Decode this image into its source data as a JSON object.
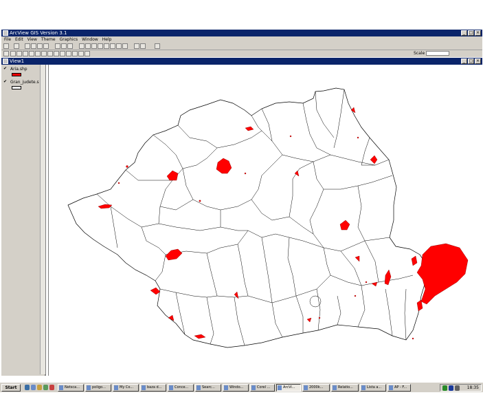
{
  "app": {
    "title": "ArcView GIS Version 3.1",
    "menus": [
      "File",
      "Edit",
      "View",
      "Theme",
      "Graphics",
      "Window",
      "Help"
    ],
    "scale_label": "Scale 1:",
    "scale_value": "",
    "coord_readout": ""
  },
  "view": {
    "title": "View1"
  },
  "legend": {
    "items": [
      {
        "name": "Aria.shp",
        "checked": true,
        "color": "#ff0000"
      },
      {
        "name": "Gran_judete.s",
        "checked": true,
        "color": "#ffffff"
      }
    ]
  },
  "taskbar": {
    "start_label": "Start",
    "tasks": [
      "Netsca...",
      "poligo...",
      "My Co...",
      "baza d...",
      "Conce...",
      "Searc...",
      "Windo...",
      "Corel ...",
      "ArcVi...",
      "2000k...",
      "Relatio...",
      "Lista a...",
      "AP - F..."
    ],
    "active_task_index": 8,
    "clock": "18:35"
  },
  "colors": {
    "title_bar": "#0a246a",
    "feature_fill": "#ff0000",
    "boundary_stroke": "#000000"
  }
}
